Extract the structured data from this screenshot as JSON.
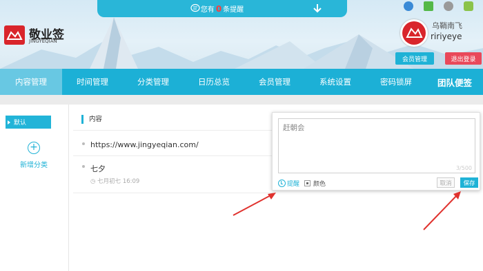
{
  "notice": {
    "prefix": "您有",
    "count": "0",
    "suffix": "条提醒"
  },
  "brand": {
    "name": "敬业签",
    "sub": "JINGYEQIAN"
  },
  "user": {
    "name": "乌鞘南飞",
    "id": "ririyeye"
  },
  "buttons": {
    "member": "会员管理",
    "logout": "退出登录"
  },
  "nav": [
    "内容管理",
    "时间管理",
    "分类管理",
    "日历总览",
    "会员管理",
    "系统设置",
    "密码锁屏",
    "团队便签"
  ],
  "sidebar": {
    "default_category": "默认",
    "add_label": "新增分类",
    "add_symbol": "+"
  },
  "content": {
    "header": "内容",
    "notes": [
      {
        "text": "https://www.jingyeqian.com/"
      },
      {
        "text": "七夕",
        "time": "七月初七 16:09"
      }
    ]
  },
  "editor": {
    "text": "赶朝会",
    "counter": "3/500",
    "remind_label": "提醒",
    "color_label": "颜色",
    "cancel_label": "取消",
    "save_label": "保存"
  },
  "colors": {
    "accent": "#1fb2d6",
    "logout": "#e9485a",
    "logo": "#d9252b",
    "arrow": "#e0322e"
  },
  "icons": [
    "bubble-icon",
    "arrow-down-icon",
    "ie-icon",
    "windows-icon",
    "apple-icon",
    "android-icon",
    "clock-icon",
    "plus-icon"
  ]
}
